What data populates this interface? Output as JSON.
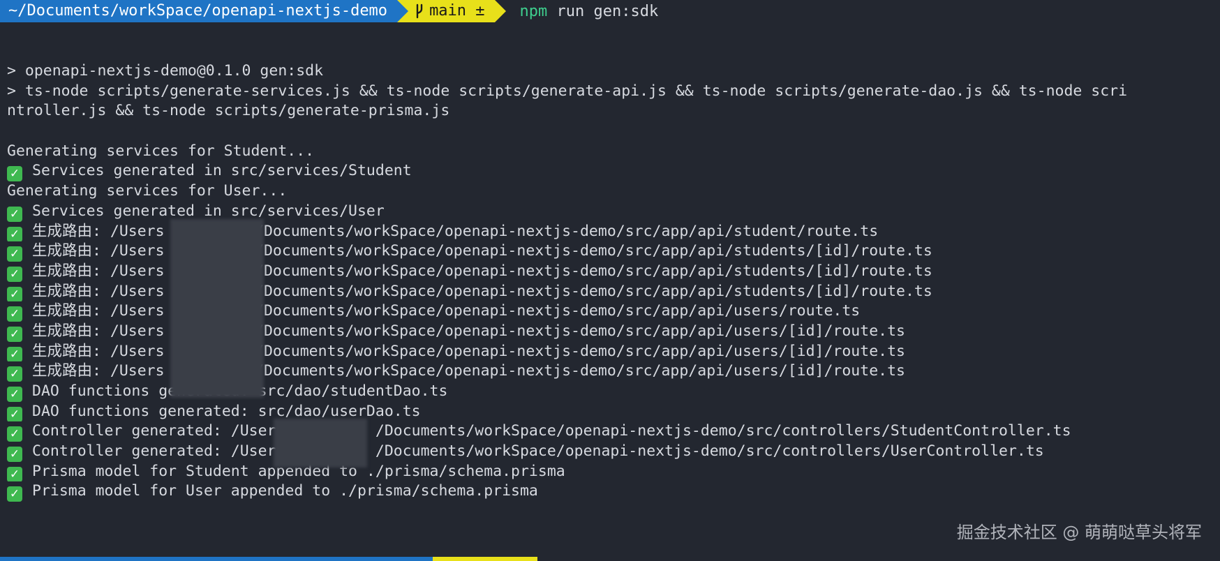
{
  "prompt": {
    "path": "~/Documents/workSpace/openapi-nextjs-demo",
    "branch": "main ±",
    "command_npm": "npm",
    "command_rest": " run gen:sdk",
    "colors": {
      "path_bg": "#1f74c5",
      "git_bg": "#e8e01a",
      "npm": "#3ecf8e"
    }
  },
  "output": [
    {
      "check": false,
      "text": "> openapi-nextjs-demo@0.1.0 gen:sdk"
    },
    {
      "check": false,
      "text": "> ts-node scripts/generate-services.js && ts-node scripts/generate-api.js && ts-node scripts/generate-dao.js && ts-node scri"
    },
    {
      "check": false,
      "text": "ntroller.js && ts-node scripts/generate-prisma.js"
    },
    {
      "check": false,
      "text": ""
    },
    {
      "check": false,
      "text": "Generating services for Student..."
    },
    {
      "check": true,
      "text": "Services generated in src/services/Student"
    },
    {
      "check": false,
      "text": "Generating services for User..."
    },
    {
      "check": true,
      "text": "Services generated in src/services/User"
    },
    {
      "check": true,
      "text": "生成路由: /Users          /Documents/workSpace/openapi-nextjs-demo/src/app/api/student/route.ts"
    },
    {
      "check": true,
      "text": "生成路由: /Users          /Documents/workSpace/openapi-nextjs-demo/src/app/api/students/[id]/route.ts"
    },
    {
      "check": true,
      "text": "生成路由: /Users          /Documents/workSpace/openapi-nextjs-demo/src/app/api/students/[id]/route.ts"
    },
    {
      "check": true,
      "text": "生成路由: /Users          /Documents/workSpace/openapi-nextjs-demo/src/app/api/students/[id]/route.ts"
    },
    {
      "check": true,
      "text": "生成路由: /Users          /Documents/workSpace/openapi-nextjs-demo/src/app/api/users/route.ts"
    },
    {
      "check": true,
      "text": "生成路由: /Users          /Documents/workSpace/openapi-nextjs-demo/src/app/api/users/[id]/route.ts"
    },
    {
      "check": true,
      "text": "生成路由: /Users          /Documents/workSpace/openapi-nextjs-demo/src/app/api/users/[id]/route.ts"
    },
    {
      "check": true,
      "text": "生成路由: /Users          /Documents/workSpace/openapi-nextjs-demo/src/app/api/users/[id]/route.ts"
    },
    {
      "check": true,
      "text": "DAO functions generated: src/dao/studentDao.ts"
    },
    {
      "check": true,
      "text": "DAO functions generated: src/dao/userDao.ts"
    },
    {
      "check": true,
      "text": "Controller generated: /Users          /Documents/workSpace/openapi-nextjs-demo/src/controllers/StudentController.ts"
    },
    {
      "check": true,
      "text": "Controller generated: /Users          /Documents/workSpace/openapi-nextjs-demo/src/controllers/UserController.ts"
    },
    {
      "check": true,
      "text": "Prisma model for Student appended to ./prisma/schema.prisma"
    },
    {
      "check": true,
      "text": "Prisma model for User appended to ./prisma/schema.prisma"
    }
  ],
  "watermark": "掘金技术社区 @ 萌萌哒草头将军"
}
